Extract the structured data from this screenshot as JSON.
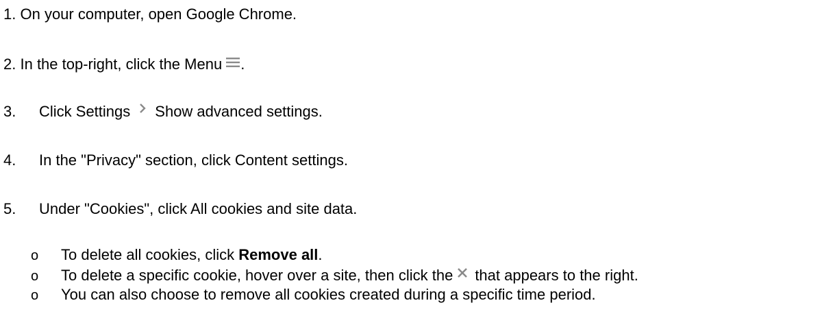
{
  "steps": [
    {
      "number": "1.",
      "text": "On your computer, open Google Chrome."
    },
    {
      "number": "2.",
      "text_before": "In the top-right, click the Menu",
      "icon": "hamburger-menu-icon",
      "text_after": "."
    },
    {
      "number": "3.",
      "text_before": "Click Settings",
      "icon": "chevron-right-icon",
      "text_after": "Show advanced settings."
    },
    {
      "number": "4.",
      "text": "In the \"Privacy\" section, click Content settings."
    },
    {
      "number": "5.",
      "text": "Under \"Cookies\", click All cookies and site data."
    }
  ],
  "sub_items": [
    {
      "bullet": "o",
      "text_before": "To delete all cookies, click ",
      "bold": "Remove all",
      "text_after": "."
    },
    {
      "bullet": "o",
      "text_before": "To delete a specific cookie, hover over a site, then click the",
      "icon": "close-x-icon",
      "text_after": "that appears to the right."
    },
    {
      "bullet": "o",
      "text": "You can also choose to remove all cookies created during a specific time period."
    }
  ],
  "colors": {
    "text": "#000000",
    "icon_gray": "#8a8a8a",
    "background": "#ffffff"
  }
}
